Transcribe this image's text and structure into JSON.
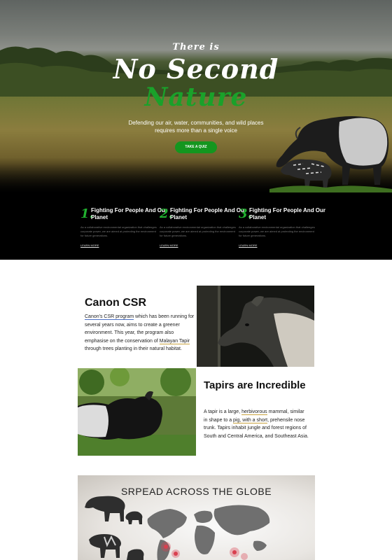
{
  "hero": {
    "kicker": "There is",
    "title_line1": "No Second",
    "title_line2": "Nature",
    "subtitle": "Defending our air, water, communities, and wild places requires more than a single voice",
    "cta_label": "TAKE A QUIZ",
    "accent_color": "#1aa12a"
  },
  "features": [
    {
      "number": "1.",
      "heading": "Fighting For People And Our Planet",
      "description": "As a collaborative environmental organization that challenges corporate power, we are aimed at protecting the environment for future generations.",
      "link": "LEARN MORE"
    },
    {
      "number": "2.",
      "heading": "Fighting For People And Our Planet",
      "description": "As a collaborative environmental organization that challenges corporate power, we are aimed at protecting the environment for future generations.",
      "link": "LEARN MORE"
    },
    {
      "number": "3.",
      "heading": "Fighting For People And Our Planet",
      "description": "As a collaborative environmental organization that challenges corporate power, we are aimed at protecting the environment for future generations.",
      "link": "LEARN MORE"
    }
  ],
  "csr": {
    "title": "Canon CSR",
    "link_text": "Canon's CSR program",
    "text_part1": " which has been running for several years now, aims to create a greener environment. This year, the program also emphasise on the conservation of ",
    "highlight": "Malayan Tapir",
    "text_part2": " through trees planting in their natural habitat."
  },
  "tapirs": {
    "title": "Tapirs are Incredible",
    "text_part1": "A tapir is a large, ",
    "highlight1": "herbivorous",
    "text_part2": " mammal, similar in shape to a ",
    "highlight2": "pig, with a short",
    "text_part3": ", prehensile nose trunk. Tapirs inhabit jungle and forest regions of South and Central America, and Southeast Asia."
  },
  "map_banner": {
    "title": "SRPEAD ACROSS THE GLOBE",
    "pin_color": "#d9404f"
  }
}
